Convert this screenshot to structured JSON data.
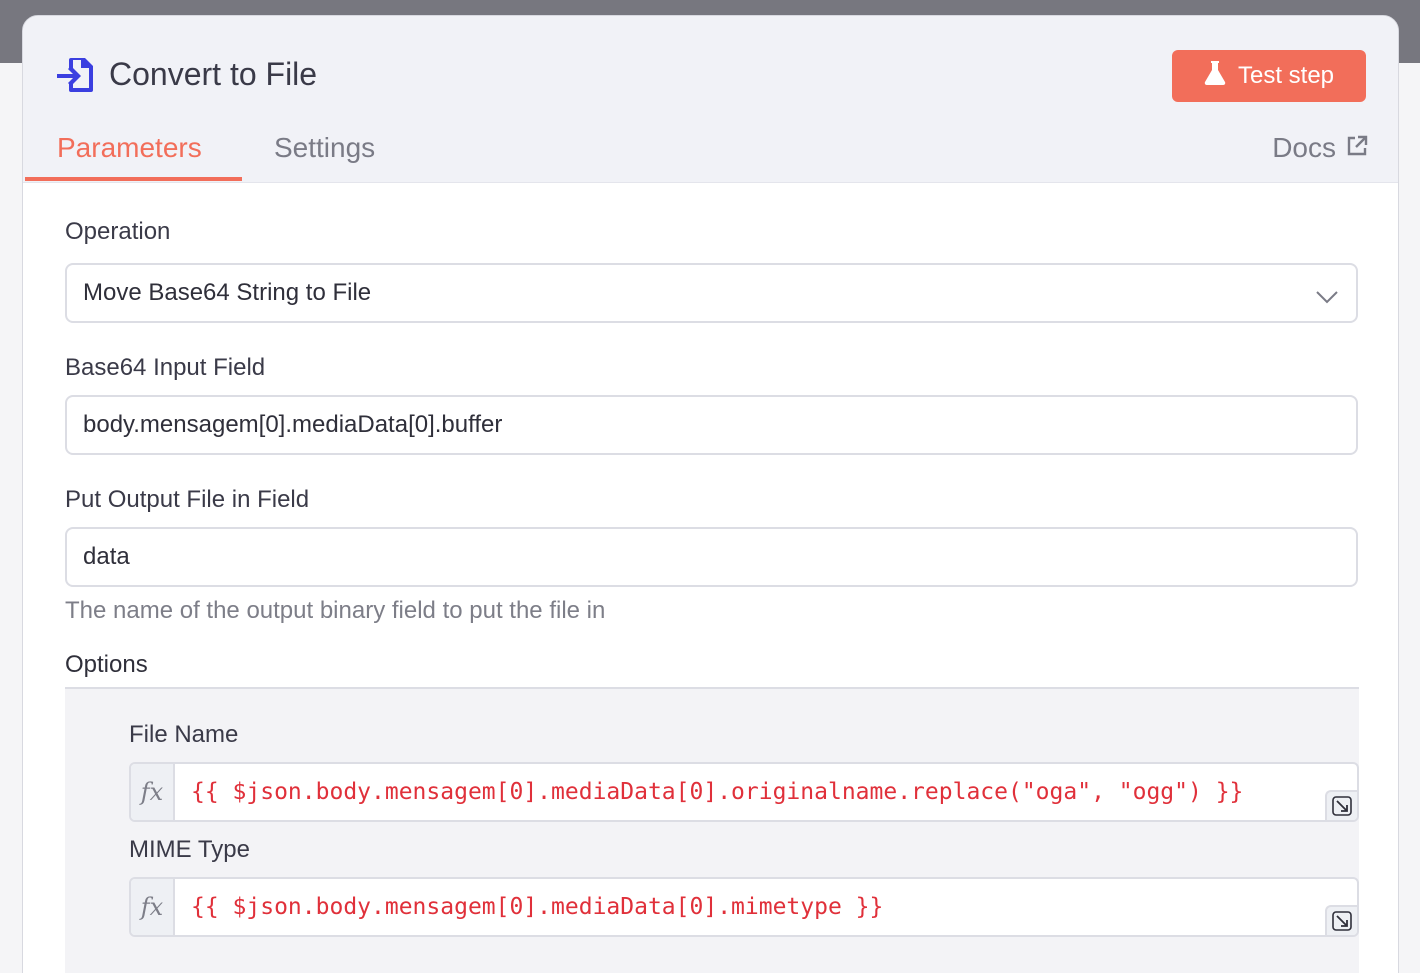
{
  "node": {
    "title": "Convert to File",
    "test_button": "Test step"
  },
  "tabs": {
    "parameters": "Parameters",
    "settings": "Settings",
    "docs": "Docs"
  },
  "fields": {
    "operation": {
      "label": "Operation",
      "value": "Move Base64 String to File"
    },
    "base64_input": {
      "label": "Base64 Input Field",
      "value": "body.mensagem[0].mediaData[0].buffer"
    },
    "output_field": {
      "label": "Put Output File in Field",
      "value": "data",
      "hint": "The name of the output binary field to put the file in"
    }
  },
  "options": {
    "label": "Options",
    "file_name": {
      "label": "File Name",
      "value": "{{ $json.body.mensagem[0].mediaData[0].originalname.replace(\"oga\", \"ogg\") }}"
    },
    "mime_type": {
      "label": "MIME Type",
      "value": "{{ $json.body.mensagem[0].mediaData[0].mimetype }}"
    }
  },
  "icons": {
    "node": "file-import-icon",
    "test": "flask-icon",
    "docs": "external-link-icon",
    "dropdown": "chevron-down-icon",
    "expression": "fx-icon",
    "expand": "expand-icon"
  },
  "colors": {
    "accent": "#f26e5a",
    "node_icon": "#3b3fe0",
    "expression_text": "#e0303a"
  }
}
